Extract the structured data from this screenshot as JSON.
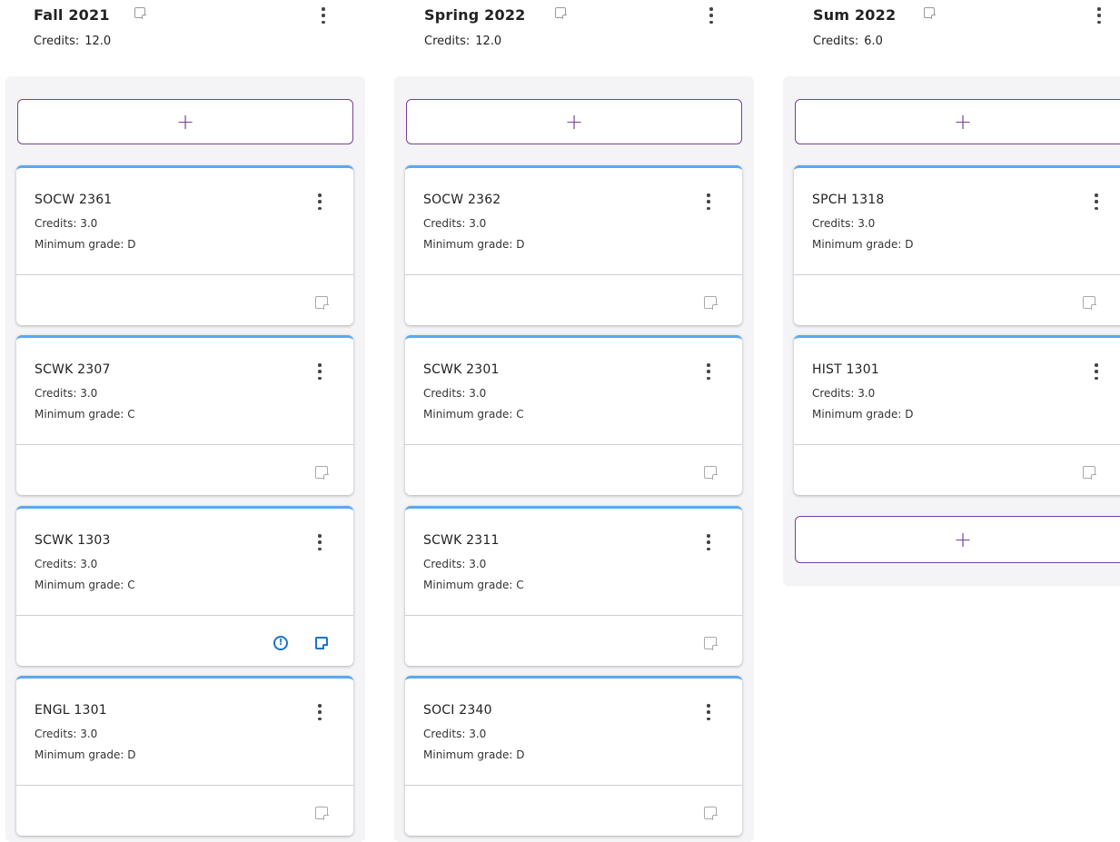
{
  "terms": [
    {
      "title": "Fall 2021",
      "credits_label": "Credits:",
      "credits_value": "12.0",
      "add_label": "+",
      "courses": [
        {
          "code": "SOCW 2361",
          "credits": "Credits: 3.0",
          "grade": "Minimum grade: D",
          "has_alert": false
        },
        {
          "code": "SCWK 2307",
          "credits": "Credits: 3.0",
          "grade": "Minimum grade: C",
          "has_alert": false
        },
        {
          "code": "SCWK 1303",
          "credits": "Credits: 3.0",
          "grade": "Minimum grade: C",
          "has_alert": true,
          "alert_glyph": "!"
        },
        {
          "code": "ENGL 1301",
          "credits": "Credits: 3.0",
          "grade": "Minimum grade: D",
          "has_alert": false
        }
      ]
    },
    {
      "title": "Spring 2022",
      "credits_label": "Credits:",
      "credits_value": "12.0",
      "add_label": "+",
      "courses": [
        {
          "code": "SOCW 2362",
          "credits": "Credits: 3.0",
          "grade": "Minimum grade: D",
          "has_alert": false
        },
        {
          "code": "SCWK 2301",
          "credits": "Credits: 3.0",
          "grade": "Minimum grade: C",
          "has_alert": false
        },
        {
          "code": "SCWK 2311",
          "credits": "Credits: 3.0",
          "grade": "Minimum grade: C",
          "has_alert": false
        },
        {
          "code": "SOCI 2340",
          "credits": "Credits: 3.0",
          "grade": "Minimum grade: D",
          "has_alert": false
        }
      ]
    },
    {
      "title": "Sum 2022",
      "credits_label": "Credits:",
      "credits_value": "6.0",
      "add_label": "+",
      "bottom_add_label": "+",
      "courses": [
        {
          "code": "SPCH 1318",
          "credits": "Credits: 3.0",
          "grade": "Minimum grade: D",
          "has_alert": false
        },
        {
          "code": "HIST 1301",
          "credits": "Credits: 3.0",
          "grade": "Minimum grade: D",
          "has_alert": false
        }
      ]
    }
  ],
  "colors": {
    "accent_purple": "#7a3f9c",
    "card_top_border": "#5ba8ee",
    "alert_blue": "#1b73c8",
    "column_bg": "#f4f4f6"
  },
  "icons": {
    "term_note": "note-icon",
    "card_note": "note-icon",
    "alert": "alert-circle-icon",
    "menu": "kebab-menu-icon",
    "add": "plus-icon"
  }
}
